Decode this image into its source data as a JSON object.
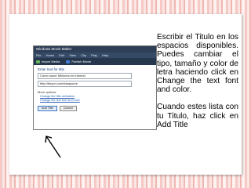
{
  "screenshot": {
    "window_title": "Windows Movie Maker",
    "menu": [
      "File",
      "Home",
      "Edit",
      "View",
      "Clip",
      "Play",
      "Help"
    ],
    "toolbar": [
      "Import Media",
      "Publish Movie"
    ],
    "pane_title": "Enter text for title",
    "input1_value": "Cómo hacer Millones en Internet",
    "input2_value": "http://tinyurl.com/ideayoure",
    "more_options_label": "More options:",
    "link_animation": "Change the title animation",
    "link_font": "Change the text font and color",
    "add_title_label": "Add Title",
    "cancel_label": "Cancel"
  },
  "slide_text": {
    "paragraph1": "Escribir el Titulo en los espacios disponibles. Puedes cambiar el tipo, tamaño y color de letra haciendo click en Change the text font and color.",
    "paragraph2": "Cuando estes lista con tu Titulo, haz click en Add Title"
  },
  "colors": {
    "background_stripes": "#f5c9c6",
    "titlebar": "#2d3e56",
    "link": "#2b5fb3"
  }
}
